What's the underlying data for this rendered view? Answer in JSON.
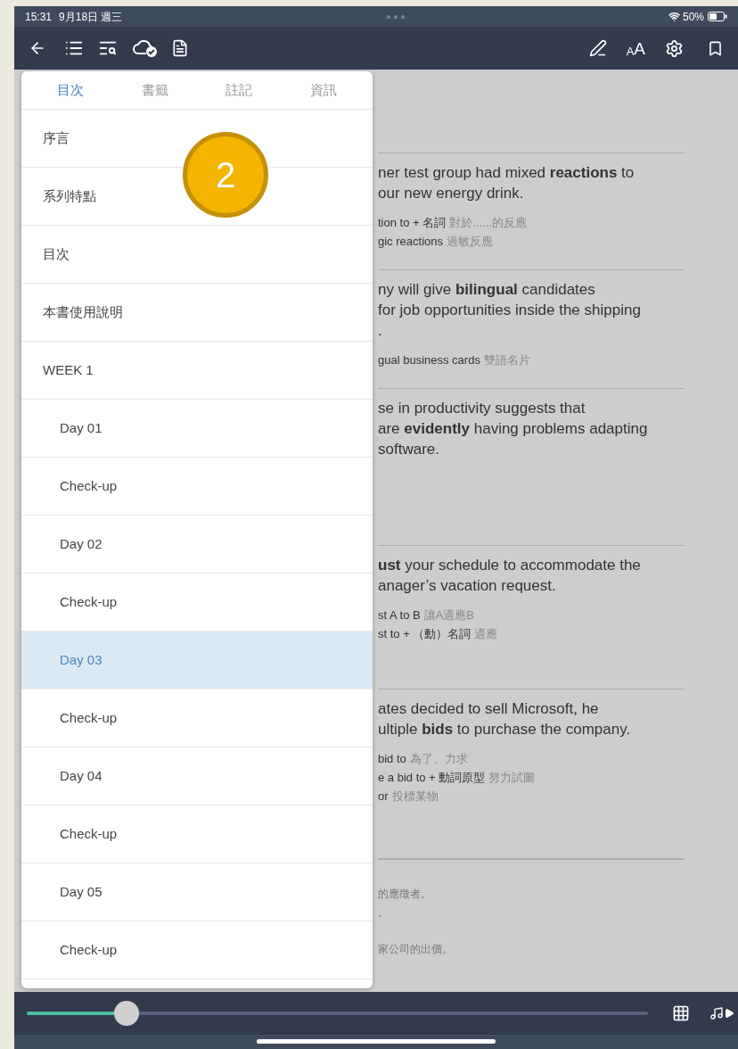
{
  "status_bar": {
    "time": "15:31",
    "date": "9月18日 週三",
    "battery": "50%"
  },
  "toolbar": {
    "font_size_button": {
      "small": "A",
      "large": "A"
    }
  },
  "toc_panel": {
    "tabs": [
      {
        "label": "目次",
        "selected": true
      },
      {
        "label": "書籤",
        "selected": false
      },
      {
        "label": "註記",
        "selected": false
      },
      {
        "label": "資訊",
        "selected": false
      }
    ],
    "items": [
      {
        "label": "序言",
        "selected": false
      },
      {
        "label": "系列特點",
        "selected": false
      },
      {
        "label": "目次",
        "selected": false
      },
      {
        "label": "本書使用說明",
        "selected": false
      },
      {
        "label": "WEEK 1",
        "selected": false,
        "children": [
          {
            "label": "Day 01",
            "selected": false
          },
          {
            "label": "Check-up",
            "selected": false
          },
          {
            "label": "Day 02",
            "selected": false
          },
          {
            "label": "Check-up",
            "selected": false
          },
          {
            "label": "Day 03",
            "selected": true
          },
          {
            "label": "Check-up",
            "selected": false
          },
          {
            "label": "Day 04",
            "selected": false
          },
          {
            "label": "Check-up",
            "selected": false
          },
          {
            "label": "Day 05",
            "selected": false
          },
          {
            "label": "Check-up",
            "selected": false
          }
        ]
      }
    ]
  },
  "step_badge": "2",
  "page": {
    "blocks": [
      {
        "sentence": [
          "ner test group had mixed **reactions** to",
          "our new energy drink."
        ],
        "notes": [
          {
            "term": "tion to + 名詞",
            "gloss": "對於......的反應"
          },
          {
            "term": "gic reactions",
            "gloss": "過敏反應"
          }
        ]
      },
      {
        "sentence": [
          "ny will give **bilingual** candidates",
          "for job opportunities inside the shipping",
          "."
        ],
        "notes": [
          {
            "term": "gual business cards",
            "gloss": "雙語名片"
          }
        ]
      },
      {
        "sentence": [
          "se in productivity suggests that",
          "are **evidently** having problems adapting",
          "software."
        ]
      },
      {
        "sentence": [
          "**ust** your schedule to accommodate the",
          "anager’s vacation request."
        ],
        "notes": [
          {
            "term": "st A to B",
            "gloss": "讓A適應B"
          },
          {
            "term": "st to + （動）名詞",
            "gloss": "適應"
          }
        ]
      },
      {
        "sentence": [
          "ates decided to sell Microsoft, he",
          "ultiple **bids** to purchase the company."
        ],
        "notes": [
          {
            "term": "bid to",
            "gloss": "為了、力求"
          },
          {
            "term": "e a bid to + 動詞原型",
            "gloss": "努力試圖"
          },
          {
            "term": "or",
            "gloss": "投標某物"
          }
        ]
      }
    ],
    "translations": [
      "的應徵者。",
      "。",
      "家公司的出價。"
    ]
  },
  "reading_progress": {
    "level": 0.16
  }
}
